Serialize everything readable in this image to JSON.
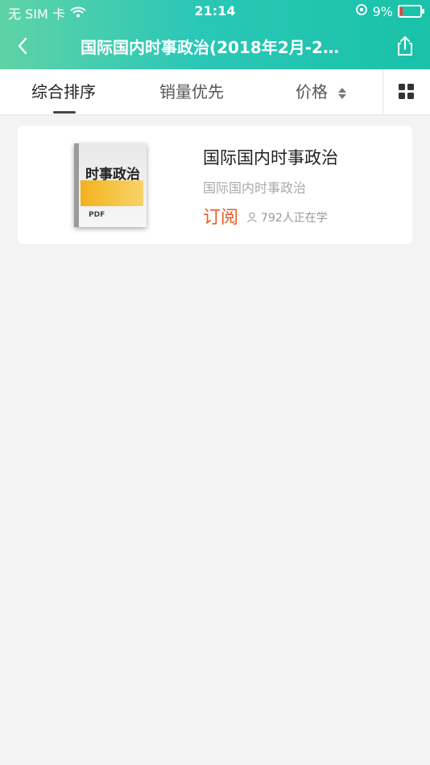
{
  "status_bar": {
    "carrier": "无 SIM 卡",
    "time": "21:14",
    "battery": "9%"
  },
  "nav": {
    "title": "国际国内时事政治(2018年2月-20..."
  },
  "tabs": [
    {
      "label": "综合排序"
    },
    {
      "label": "销量优先"
    },
    {
      "label": "价格"
    }
  ],
  "products": [
    {
      "cover_title": "时事政治",
      "cover_badge": "PDF",
      "name": "国际国内时事政治",
      "subtitle": "国际国内时事政治",
      "action": "订阅",
      "learners": "792人正在学"
    }
  ],
  "colors": {
    "accent": "#f25a1e",
    "header_start": "#5fd3a6",
    "header_end": "#19c2a8"
  }
}
